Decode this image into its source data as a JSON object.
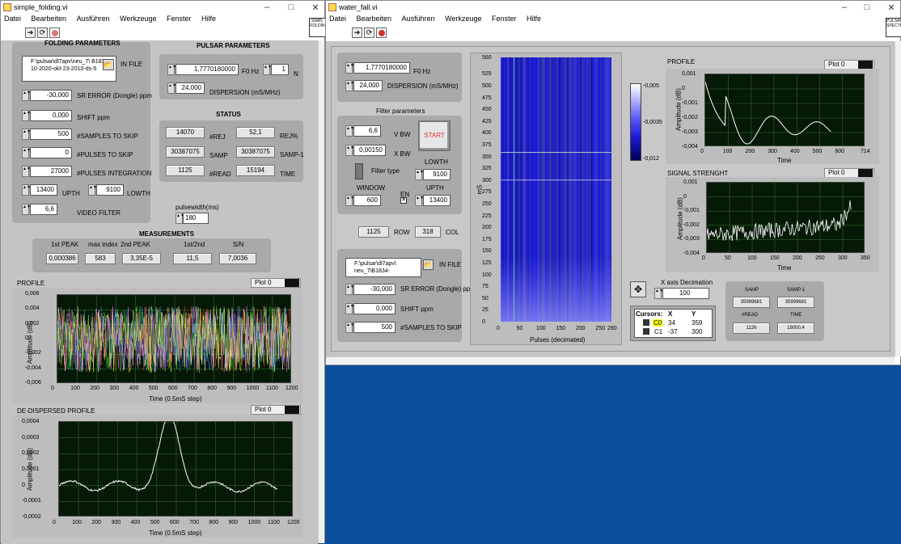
{
  "win1": {
    "title": "simple_folding.vi",
    "menu": [
      "Datei",
      "Bearbeiten",
      "Ausführen",
      "Werkzeuge",
      "Fenster",
      "Hilfe"
    ],
    "folding_title": "FOLDING PARAMETERS",
    "in_file_path": "F:\\pulsar\\dl7apv\\neu_7\\ B1834-10-2020-okt-23-2010-ds-5",
    "in_file_label": "IN FILE",
    "sr_error": "-30,000",
    "sr_error_label": "SR ERROR (Dongle) ppm",
    "shift": "0,000",
    "shift_label": "SHIFT ppm",
    "samples_skip": "500",
    "samples_skip_label": "#SAMPLES TO SKIP",
    "pulses_skip": "0",
    "pulses_skip_label": "#PULSES TO SKIP",
    "pulses_int": "27000",
    "pulses_int_label": "#PULSES INTEGRATION",
    "upth": "13400",
    "upth_label": "UPTH",
    "lowth": "9100",
    "lowth_label": "LOWTH",
    "video_filter": "6,6",
    "video_filter_label": "VIDEO FILTER",
    "pulsar_title": "PULSAR PARAMETERS",
    "f0": "1,7770180000",
    "f0_label": "F0 Hz",
    "n": "1",
    "n_label": "N",
    "dispersion": "24,000",
    "dispersion_label": "DISPERSION (mS/MHz)",
    "status_title": "STATUS",
    "rej": "14070",
    "rej_label": "#REJ",
    "rejpct": "52,1",
    "rejpct_label": "REJ%",
    "samp": "30387075",
    "samp_label": "SAMP",
    "samp1": "30387075",
    "samp1_label": "SAMP-1",
    "read": "1125",
    "read_label": "#READ",
    "time": "15194",
    "time_label": "TIME",
    "pulsewidth_label": "pulsewidth(ms)",
    "pulsewidth": "180",
    "meas_title": "MEASUREMENTS",
    "meas_headers": [
      "1st PEAK",
      "max index",
      "2nd PEAK",
      "1st/2nd",
      "S/N"
    ],
    "meas_values": [
      "0,000386",
      "583",
      "3,35E-5",
      "11,5",
      "7,0036"
    ],
    "profile_title": "PROFILE",
    "profile_plot": "Plot 0",
    "profile_ylabel": "Amplitude (dB)",
    "profile_xlabel": "Time (0.5mS step)",
    "profile_yticks": [
      "0,006",
      "0,004",
      "0,002",
      "0",
      "-0,002",
      "-0,004",
      "-0,006"
    ],
    "profile_xticks": [
      "0",
      "100",
      "200",
      "300",
      "400",
      "500",
      "600",
      "700",
      "800",
      "900",
      "1000",
      "1100",
      "1200"
    ],
    "dd_title": "DE-DISPERSED PROFILE",
    "dd_plot": "Plot 0",
    "dd_ylabel": "Amplitude (dB)",
    "dd_xlabel": "Time (0.5mS step)",
    "dd_yticks": [
      "0,0004",
      "0,0003",
      "0,0002",
      "0,0001",
      "0",
      "-0,0001",
      "-0,0002"
    ],
    "dd_xticks": [
      "0",
      "100",
      "200",
      "300",
      "400",
      "500",
      "600",
      "700",
      "800",
      "900",
      "1000",
      "1100",
      "1200"
    ],
    "side_label": "SIMPL FOLDIN"
  },
  "win2": {
    "title": "water_fall.vi",
    "menu": [
      "Datei",
      "Bearbeiten",
      "Ausführen",
      "Werkzeuge",
      "Fenster",
      "Hilfe"
    ],
    "f0": "1,7770180000",
    "f0_label": "F0 Hz",
    "dispersion": "24,000",
    "dispersion_label": "DISPERSION (mS/MHz)",
    "filter_title": "Filter parameters",
    "vbw": "6,6",
    "vbw_label": "V BW",
    "xbw": "0,00150",
    "xbw_label": "X BW",
    "start_label": "START",
    "filter_type_label": "Filter type",
    "lowth_label": "LOWTH",
    "lowth": "9100",
    "window_label": "WINDOW",
    "window": "600",
    "en_label": "EN",
    "upth_label": "UPTH",
    "upth": "13400",
    "row": "1125",
    "row_label": "ROW",
    "col": "318",
    "col_label": "COL",
    "in_file_path": "F:\\pulsar\\dl7apv\\ neu_7\\B1834-",
    "in_file_label": "IN FILE",
    "sr_error": "-30,000",
    "sr_error_label": "SR ERROR (Dongle) ppm",
    "shift": "0,000",
    "shift_label": "SHIFT ppm",
    "samples_skip": "500",
    "samples_skip_label": "#SAMPLES TO SKIP",
    "wf_yticks": [
      "560",
      "525",
      "500",
      "475",
      "450",
      "425",
      "400",
      "375",
      "350",
      "325",
      "300",
      "275",
      "250",
      "225",
      "200",
      "175",
      "150",
      "125",
      "100",
      "75",
      "50",
      "25",
      "0"
    ],
    "wf_xticks": [
      "0",
      "50",
      "100",
      "150",
      "200",
      "250",
      "280"
    ],
    "wf_ylabel": "mS",
    "wf_xlabel": "Pulses (decimated)",
    "scale_ticks": [
      "-0,005",
      "-0,0035",
      "-0,012"
    ],
    "profile_title": "PROFILE",
    "profile_plot": "Plot 0",
    "profile_ylabel": "Amplitude (dB)",
    "profile_xlabel": "Time",
    "profile_yticks": [
      "0,001",
      "0",
      "-0,001",
      "-0,002",
      "-0,003",
      "-0,004"
    ],
    "profile_xticks": [
      "0",
      "100",
      "200",
      "300",
      "400",
      "500",
      "600",
      "714"
    ],
    "signal_title": "SIGNAL STRENGHT",
    "signal_plot": "Plot 0",
    "signal_ylabel": "Amplitude (dB)",
    "signal_xlabel": "Time",
    "signal_yticks": [
      "0,001",
      "0",
      "-0,001",
      "-0,002",
      "-0,003",
      "-0,004"
    ],
    "signal_xticks": [
      "0",
      "50",
      "100",
      "150",
      "200",
      "250",
      "300",
      "350"
    ],
    "xdec_label": "X axis Decimation",
    "xdec": "100",
    "cursors_headers": [
      "Cursors:",
      "X",
      "Y"
    ],
    "cursors": [
      {
        "name": "C0",
        "x": "34",
        "y": "359"
      },
      {
        "name": "C1",
        "x": "-37",
        "y": "300"
      }
    ],
    "samp_label": "SAMP",
    "samp": "35999681",
    "samp1_label": "SAMP-1",
    "samp1": "35999681",
    "read_label": "#READ",
    "read": "1126",
    "time_label": "TIME",
    "time": "18000,4",
    "side_label": "PULSAR SPECTR"
  }
}
